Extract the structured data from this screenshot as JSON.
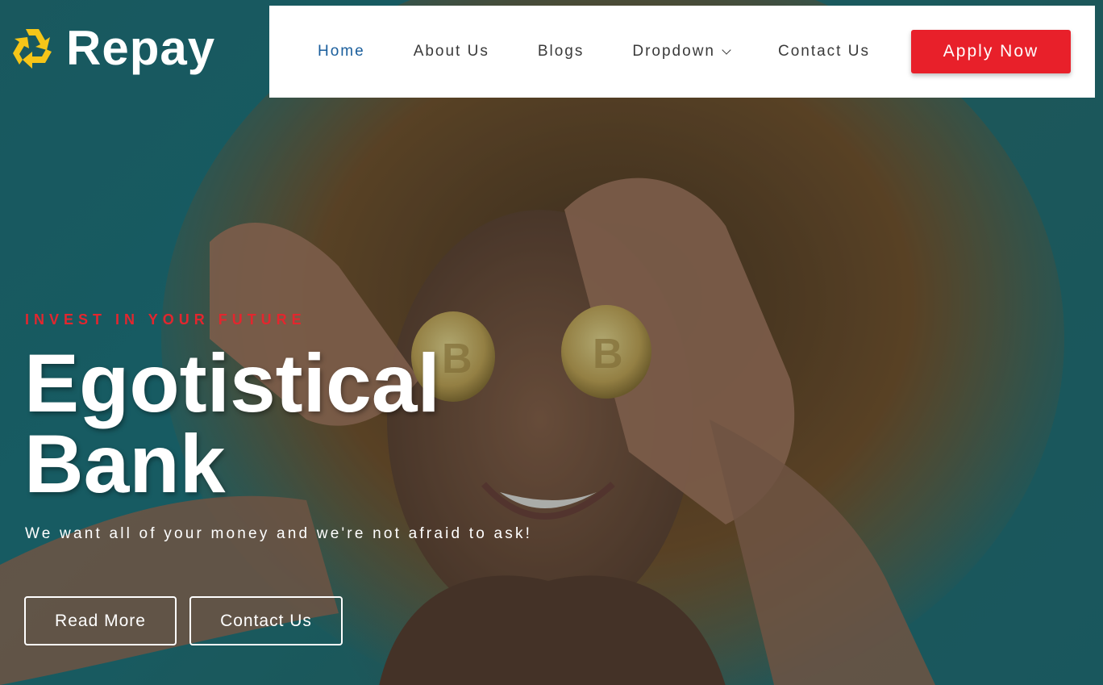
{
  "brand": {
    "name": "Repay",
    "logo_icon": "recycle-icon",
    "logo_color": "#f5c518"
  },
  "nav": {
    "items": [
      {
        "label": "Home",
        "active": true
      },
      {
        "label": "About Us"
      },
      {
        "label": "Blogs"
      },
      {
        "label": "Dropdown",
        "icon": "chevron-down-icon"
      },
      {
        "label": "Contact Us"
      }
    ],
    "active_color": "#1a5e9c",
    "cta_label": "Apply Now",
    "cta_color": "#e8202a"
  },
  "hero": {
    "eyebrow": "INVEST IN YOUR FUTURE",
    "title_line1": "Egotistical",
    "title_line2": "Bank",
    "tagline": "We want all of your money and we're not afraid to ask!",
    "primary_button": "Read More",
    "secondary_button": "Contact Us",
    "accent_color": "#e3262e",
    "background_color": "#1f6b71"
  }
}
